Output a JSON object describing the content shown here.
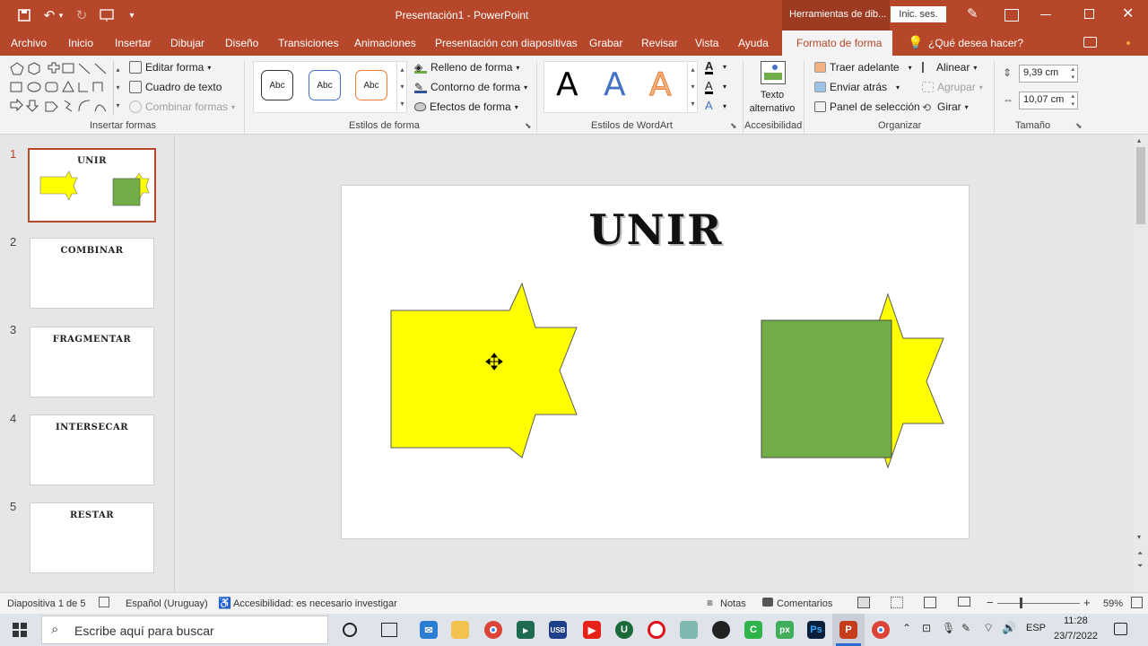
{
  "window": {
    "title": "Presentación1  -  PowerPoint",
    "contextual_tab_group": "Herramientas de dib...",
    "sign_in": "Inic. ses."
  },
  "tabs": [
    "Archivo",
    "Inicio",
    "Insertar",
    "Dibujar",
    "Diseño",
    "Transiciones",
    "Animaciones",
    "Presentación con diapositivas",
    "Grabar",
    "Revisar",
    "Vista",
    "Ayuda",
    "Formato de forma"
  ],
  "active_tab": "Formato de forma",
  "tell_me": "¿Qué desea hacer?",
  "ribbon": {
    "insert_shapes": {
      "label": "Insertar formas",
      "edit_shape": "Editar forma",
      "text_box": "Cuadro de texto",
      "merge_shapes": "Combinar formas"
    },
    "shape_styles": {
      "label": "Estilos de forma",
      "style_samples": [
        "Abc",
        "Abc",
        "Abc"
      ],
      "fill": "Relleno de forma",
      "outline": "Contorno de forma",
      "effects": "Efectos de forma"
    },
    "wordart": {
      "label": "Estilos de WordArt",
      "samples": [
        "A",
        "A",
        "A"
      ]
    },
    "accessibility": {
      "label": "Accesibilidad",
      "alt_text_line1": "Texto",
      "alt_text_line2": "alternativo"
    },
    "arrange": {
      "label": "Organizar",
      "bring_forward": "Traer adelante",
      "send_backward": "Enviar atrás",
      "selection_pane": "Panel de selección",
      "align": "Alinear",
      "group": "Agrupar",
      "rotate": "Girar"
    },
    "size": {
      "label": "Tamaño",
      "height": "9,39 cm",
      "width": "10,07 cm"
    }
  },
  "slides": [
    {
      "number": "1",
      "title": "UNIR"
    },
    {
      "number": "2",
      "title": "COMBINAR"
    },
    {
      "number": "3",
      "title": "FRAGMENTAR"
    },
    {
      "number": "4",
      "title": "INTERSECAR"
    },
    {
      "number": "5",
      "title": "RESTAR"
    }
  ],
  "current_slide": {
    "title": "UNIR",
    "colors": {
      "yellow": "#ffff00",
      "green": "#70ad47",
      "outline": "#5a5a5a"
    }
  },
  "status": {
    "slide_indicator": "Diapositiva 1 de 5",
    "language": "Español (Uruguay)",
    "accessibility": "Accesibilidad: es necesario investigar",
    "notes": "Notas",
    "comments": "Comentarios",
    "zoom": "59%"
  },
  "taskbar": {
    "search_placeholder": "Escribe aquí para buscar",
    "language": "ESP",
    "time": "11:28",
    "date": "23/7/2022"
  },
  "colors": {
    "accent": "#b7472a",
    "ribbon_bg": "#f3f3f3"
  }
}
